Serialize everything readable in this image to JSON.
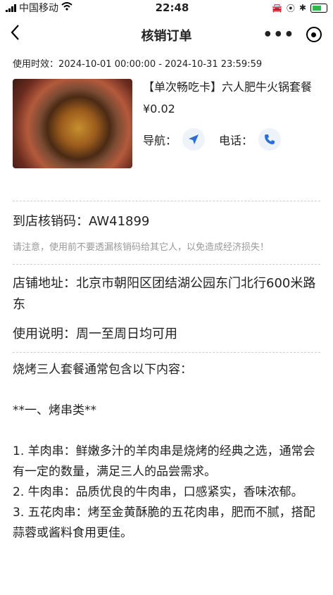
{
  "status_bar": {
    "carrier": "中国移动",
    "time": "22:48"
  },
  "header": {
    "back_icon": "chevron-left-icon",
    "title": "核销订单"
  },
  "validity": {
    "label": "使用时效：",
    "value": "2024-10-01 00:00:00 - 2024-10-31 23:59:59"
  },
  "product": {
    "name": "【单次畅吃卡】六人肥牛火锅套餐",
    "price": "¥0.02",
    "nav_label": "导航：",
    "phone_label": "电话："
  },
  "verification": {
    "code_text": "到店核销码：AW41899",
    "notice": "请注意，使用前不要透漏核销码给其它人，以免造成经济损失！"
  },
  "store": {
    "address_text": "店铺地址：北京市朝阳区团结湖公园东门北行600米路东",
    "usage_text": "使用说明：周一至周日均可用"
  },
  "description": {
    "intro": "烧烤三人套餐通常包含以下内容：",
    "section": "**一、烤串类**",
    "items": [
      "1. 羊肉串：鲜嫩多汁的羊肉串是烧烤的经典之选，通常会有一定的数量，满足三人的品尝需求。",
      "2. 牛肉串：品质优良的牛肉串，口感紧实，香味浓郁。",
      "3. 五花肉串：烤至金黄酥脆的五花肉串，肥而不腻，搭配蒜蓉或酱料食用更佳。"
    ]
  }
}
